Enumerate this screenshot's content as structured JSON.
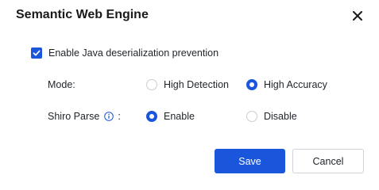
{
  "dialog": {
    "title": "Semantic Web Engine",
    "close_icon": "close-icon"
  },
  "java_deserialization": {
    "label": "Enable Java deserialization prevention",
    "checked": true
  },
  "mode": {
    "label": "Mode:",
    "options": [
      {
        "label": "High Detection",
        "checked": false
      },
      {
        "label": "High Accuracy",
        "checked": true
      }
    ]
  },
  "shiro_parse": {
    "label": "Shiro Parse",
    "colon": ":",
    "info_icon": "info-icon",
    "options": [
      {
        "label": "Enable",
        "checked": true
      },
      {
        "label": "Disable",
        "checked": false
      }
    ]
  },
  "buttons": {
    "save": "Save",
    "cancel": "Cancel"
  },
  "colors": {
    "primary": "#1a56db",
    "text": "#1f2329",
    "border": "#d0d4da"
  }
}
